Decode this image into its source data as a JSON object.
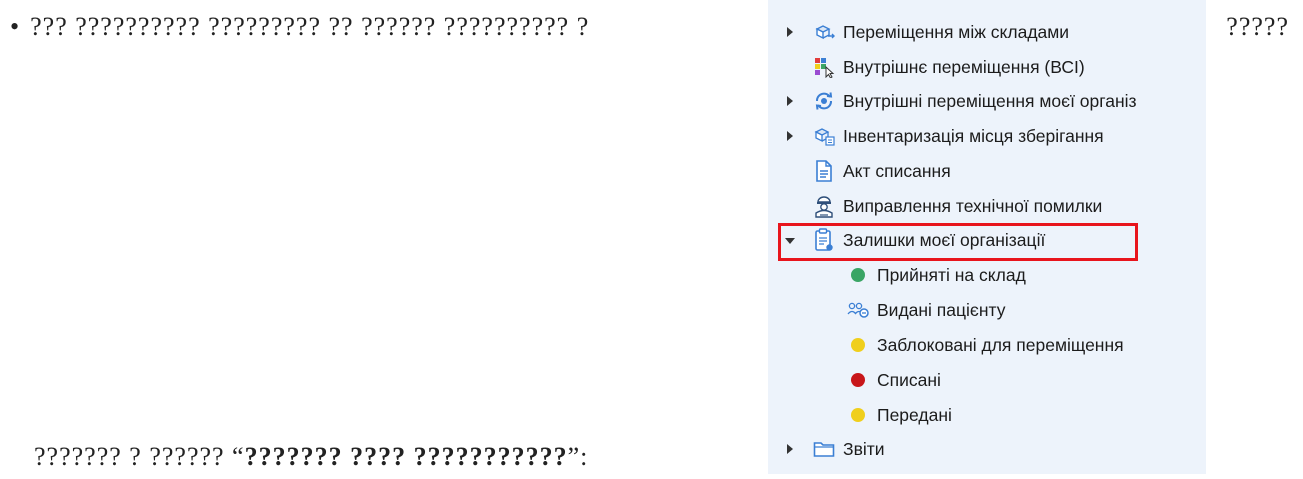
{
  "document": {
    "bullet": "•",
    "line1_left": "??? ?????????? ????????? ?? ?????? ?????????? ?",
    "line1_right": "?????",
    "line2_prefix": "??????? ? ?????? “",
    "line2_bold": "??????? ???? ???????????",
    "line2_suffix": "”:"
  },
  "tree": {
    "items": [
      {
        "label": "Переміщення між складами",
        "icon": "boxes-move-icon",
        "expandable": true,
        "expanded": false
      },
      {
        "label": "Внутрішнє переміщення (ВСІ)",
        "icon": "color-grid-cursor-icon",
        "expandable": false
      },
      {
        "label": "Внутрішні переміщення моєї організ",
        "icon": "circular-arrows-icon",
        "expandable": true,
        "expanded": false
      },
      {
        "label": "Інвентаризація місця зберігання",
        "icon": "boxes-inventory-icon",
        "expandable": true,
        "expanded": false
      },
      {
        "label": "Акт списання",
        "icon": "document-icon",
        "expandable": false
      },
      {
        "label": "Виправлення технічної помилки",
        "icon": "technician-icon",
        "expandable": false
      },
      {
        "label": "Залишки моєї організації",
        "icon": "clipboard-icon",
        "expandable": true,
        "expanded": true
      }
    ],
    "children": [
      {
        "label": "Прийняті на склад",
        "icon": "green-dot-icon",
        "color": "#3aa565"
      },
      {
        "label": "Видані пацієнту",
        "icon": "patients-icon",
        "color": "#3b7fd4"
      },
      {
        "label": "Заблоковані для переміщення",
        "icon": "yellow-dot-icon",
        "color": "#f0cf1c"
      },
      {
        "label": "Списані",
        "icon": "red-dot-icon",
        "color": "#c8161a"
      },
      {
        "label": "Передані",
        "icon": "yellow-dot-icon",
        "color": "#f0cf1c"
      }
    ],
    "footer_item": {
      "label": "Звіти",
      "icon": "folder-icon",
      "expandable": true,
      "expanded": false
    }
  },
  "colors": {
    "panel_bg": "#edf3fb",
    "highlight": "#e8141c",
    "icon_blue": "#3b7fd4"
  }
}
